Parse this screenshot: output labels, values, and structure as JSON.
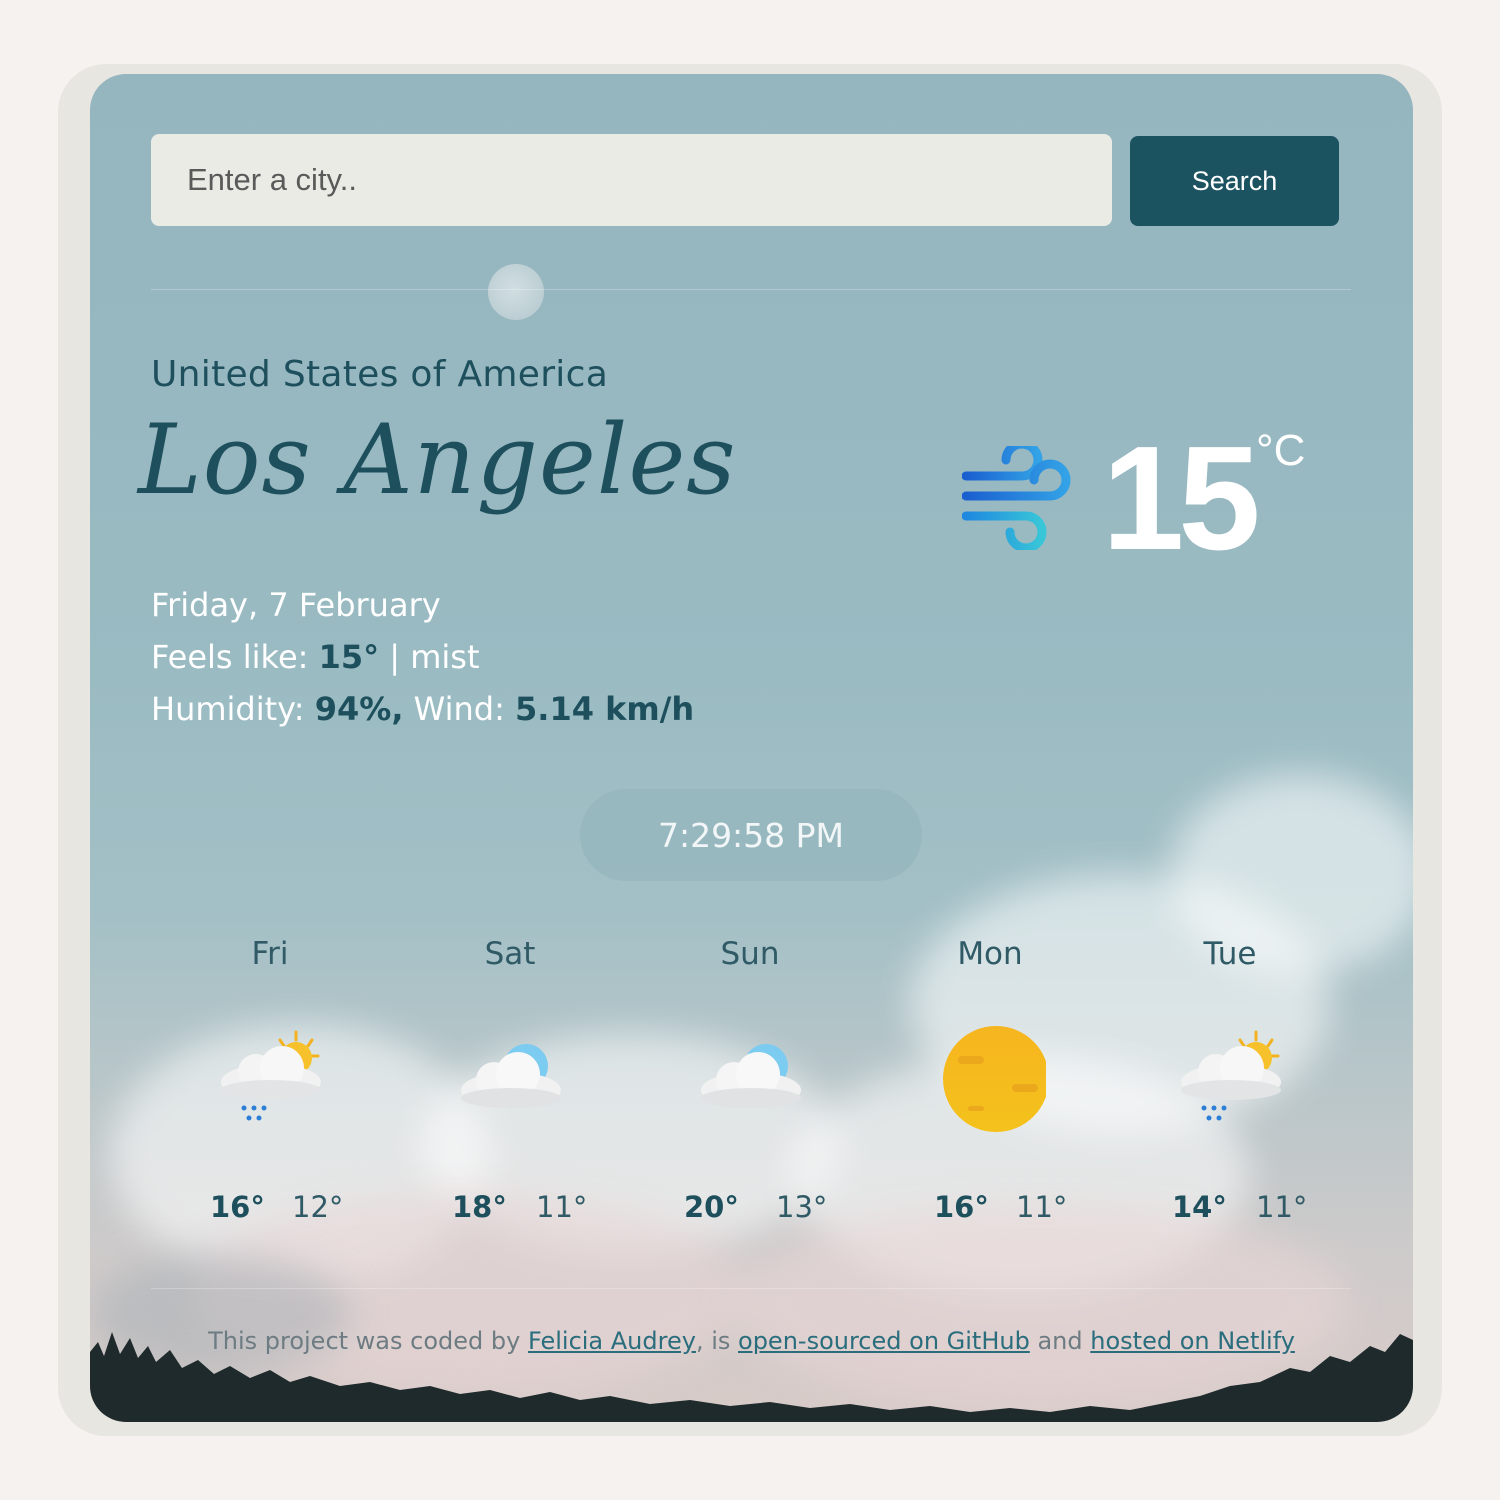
{
  "search": {
    "placeholder": "Enter a city..",
    "button_label": "Search"
  },
  "location": {
    "country": "United States of America",
    "city": "Los Angeles"
  },
  "current": {
    "date": "Friday, 7 February",
    "feels_like_label": "Feels like:",
    "feels_like_value": "15°",
    "separator": "|",
    "description": "mist",
    "humidity_label": "Humidity:",
    "humidity_value": "94%,",
    "wind_label": "Wind:",
    "wind_value": "5.14 km/h",
    "temperature": "15",
    "unit": "°C",
    "icon": "wind-icon"
  },
  "clock": "7:29:58 PM",
  "forecast": [
    {
      "day": "Fri",
      "icon": "rain-sun-icon",
      "high": "16°",
      "low": "12°"
    },
    {
      "day": "Sat",
      "icon": "cloud-icon",
      "high": "18°",
      "low": "11°"
    },
    {
      "day": "Sun",
      "icon": "cloud-icon",
      "high": "20°",
      "low": "13°"
    },
    {
      "day": "Mon",
      "icon": "sun-icon",
      "high": "16°",
      "low": "11°"
    },
    {
      "day": "Tue",
      "icon": "rain-sun-icon",
      "high": "14°",
      "low": "11°"
    }
  ],
  "footer": {
    "text_1": "This project was coded by",
    "author_link": "Felicia Audrey",
    "text_2": ", is",
    "github_link": "open-sourced on GitHub",
    "text_3": "and",
    "netlify_link": "hosted on Netlify"
  },
  "colors": {
    "accent": "#1c5361",
    "text_dark": "#1d4f5d",
    "input_bg": "#ebebe6"
  }
}
